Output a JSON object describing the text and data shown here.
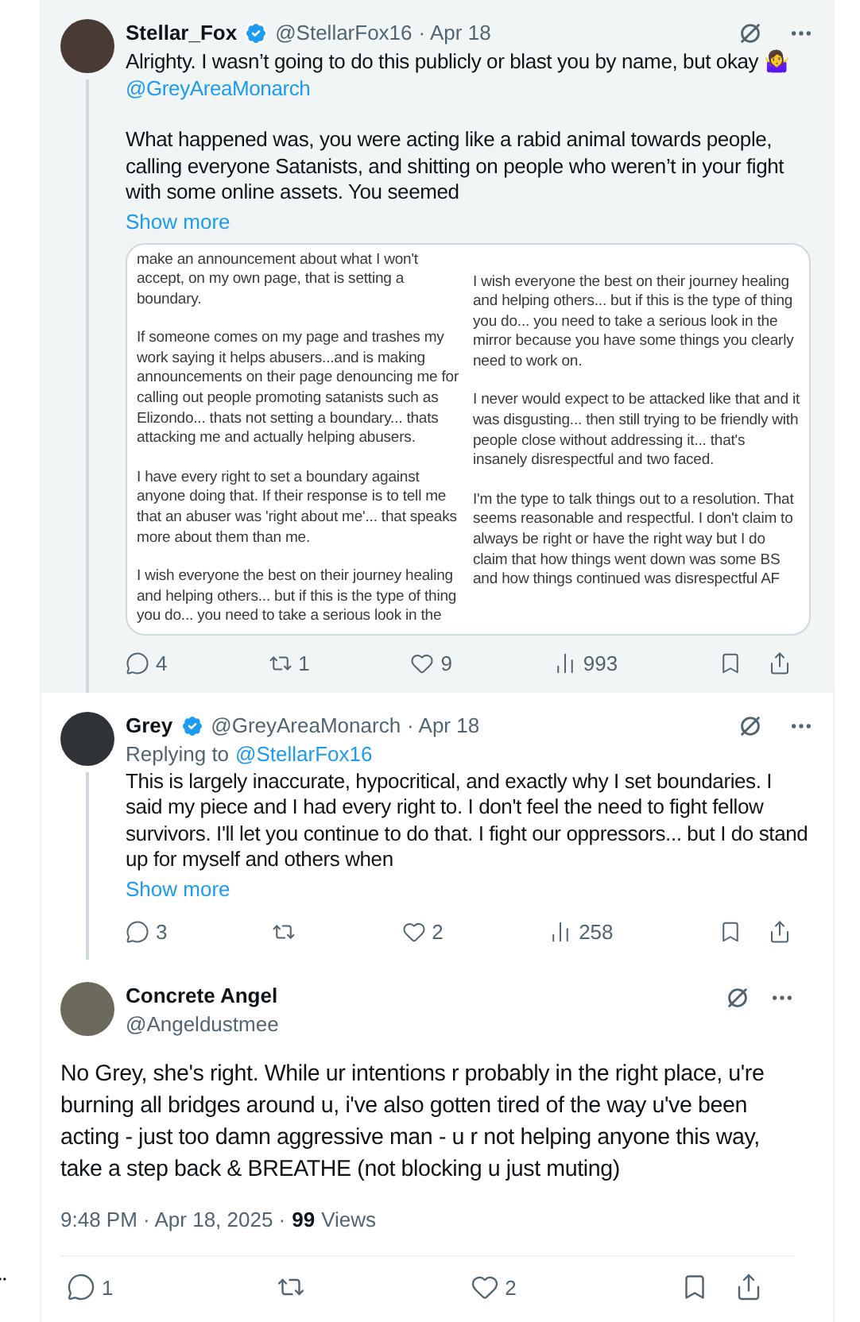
{
  "tweets": [
    {
      "name": "Stellar_Fox",
      "verified": true,
      "handle": "@StellarFox16",
      "time": "· Apr 18",
      "highlighted": true,
      "paragraphs": [
        [
          {
            "kind": "text",
            "text": "Alrighty. I wasn’t going to do this publicly or blast you by name, but okay 🤷‍♀️ "
          },
          {
            "kind": "mention",
            "text": "@GreyAreaMonarch"
          }
        ],
        [
          {
            "kind": "text",
            "text": "What happened was, you were acting like a rabid animal towards people, calling everyone Satanists, and shitting on people who weren’t in your fight with some online assets. You seemed"
          }
        ]
      ],
      "show_more": "Show more",
      "image_columns": [
        [
          "make an announcement about what I won't accept, on my own page, that is setting a boundary.",
          "If someone comes on my page and trashes my work saying it helps abusers...and is making announcements on their page denouncing me for calling out people promoting satanists such as Elizondo... thats not setting a boundary... thats attacking me and actually helping abusers.",
          "I have every right to set a boundary against anyone doing that. If their response is to tell me that an abuser was 'right about me'... that speaks more about them than me.",
          "I wish everyone the best on their journey healing and helping others... but if this is the type of thing you do... you need to take a serious look in the"
        ],
        [
          "I wish everyone the best on their journey healing and helping others... but if this is the type of thing you do... you need to take a serious look in the mirror because you have some things you clearly need to work on.",
          "I never would expect to be attacked like that and it was disgusting... then still trying to be friendly with people close without addressing it... that's insanely disrespectful and two faced.",
          "I'm the type to talk things out to a resolution. That seems reasonable and respectful. I don't claim to always be right or have the right way but I do claim that how things went down was some BS and how things continued was disrespectful AF"
        ]
      ],
      "actions": {
        "replies": "4",
        "reposts": "1",
        "likes": "9",
        "views": "993"
      }
    },
    {
      "name": "Grey",
      "verified": true,
      "handle": "@GreyAreaMonarch",
      "time": "· Apr 18",
      "highlighted": false,
      "replying_label": "Replying to",
      "replying_to": "@StellarFox16",
      "paragraphs": [
        [
          {
            "kind": "text",
            "text": "This is largely inaccurate, hypocritical, and exactly why I set boundaries. I said my piece and I had every right to. I don't feel the need to fight fellow survivors. I'll let you continue to do that. I fight our oppressors... but I do stand up for myself and others when"
          }
        ]
      ],
      "show_more": "Show more",
      "actions": {
        "replies": "3",
        "likes": "2",
        "views": "258"
      }
    }
  ],
  "focused": {
    "name": "Concrete Angel",
    "handle": "@Angeldustmee",
    "text": "No Grey, she's right. While ur intentions r probably in the right place, u're burning all bridges around u, i've also gotten tired of the way u've been acting - just too damn aggressive man - u r not helping anyone this way, take a step back & BREATHE (not blocking u just muting)",
    "timestamp": "9:48 PM · Apr 18, 2025 ·",
    "views_count": "99",
    "views_label": "Views",
    "actions": {
      "replies": "1",
      "likes": "2"
    }
  }
}
